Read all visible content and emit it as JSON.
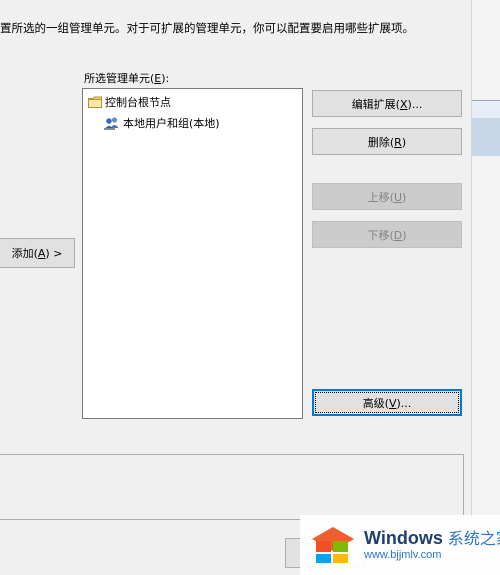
{
  "dialog": {
    "description_text": "置所选的一组管理单元。对于可扩展的管理单元，你可以配置要启用哪些扩展项。",
    "add_button": {
      "label": "添加(",
      "key": "A",
      "suffix": ") >"
    }
  },
  "selected_snapins": {
    "label": "所选管理单元(",
    "key": "E",
    "suffix": "):",
    "tree": [
      {
        "label": "控制台根节点",
        "icon": "folder-icon"
      },
      {
        "label": "本地用户和组(本地)",
        "icon": "users-group-icon"
      }
    ]
  },
  "buttons": {
    "edit_extensions": {
      "label": "编辑扩展(",
      "key": "X",
      "suffix": ")..."
    },
    "delete": {
      "label": "删除(",
      "key": "R",
      "suffix": ")"
    },
    "move_up": {
      "label": "上移(",
      "key": "U",
      "suffix": ")"
    },
    "move_down": {
      "label": "下移(",
      "key": "D",
      "suffix": ")"
    },
    "advanced": {
      "label": "高级(",
      "key": "V",
      "suffix": ")..."
    }
  },
  "watermark": {
    "brand": "Windows",
    "brand_cn": "系统之家",
    "url": "www.bjjmlv.com"
  },
  "colors": {
    "dialog_bg": "#f0f0f0",
    "button_bg": "#e1e1e1",
    "button_border": "#adadad",
    "disabled_bg": "#cccccc",
    "disabled_text": "#838383",
    "focus_border": "#0078d7",
    "watermark_blue": "#2b74c8"
  }
}
